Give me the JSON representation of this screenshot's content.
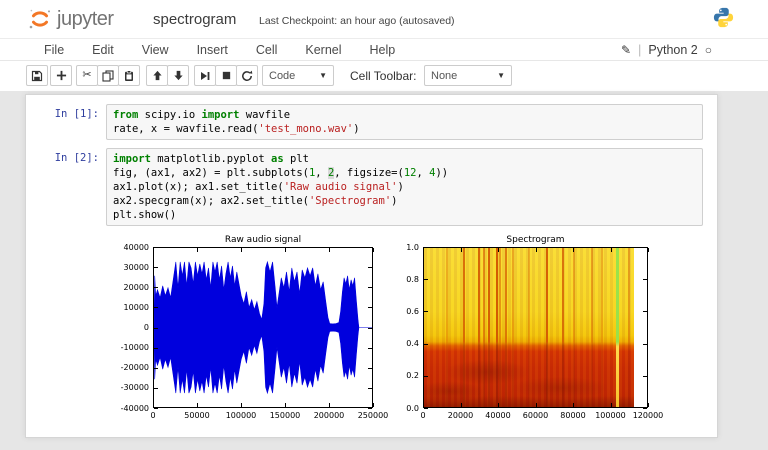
{
  "header": {
    "logo_word": "jupyter",
    "title": "spectrogram",
    "checkpoint": "Last Checkpoint: an hour ago (autosaved)"
  },
  "menu": {
    "items": [
      "File",
      "Edit",
      "View",
      "Insert",
      "Cell",
      "Kernel",
      "Help"
    ],
    "kernel_name": "Python 2"
  },
  "toolbar": {
    "buttons": [
      "save",
      "add-cell",
      "cut",
      "copy",
      "paste",
      "move-up",
      "move-down",
      "run",
      "stop",
      "restart-kernel"
    ],
    "cell_type_value": "Code",
    "cell_toolbar_label": "Cell Toolbar:",
    "cell_toolbar_value": "None"
  },
  "syntax_colors": {
    "kw": "#008000",
    "str": "#BA2121",
    "num": "#008000",
    "pl": "#000000",
    "prompt": "#303F9F"
  },
  "cells": [
    {
      "prompt": "In [1]:",
      "lines": [
        [
          {
            "t": "kw",
            "v": "from"
          },
          {
            "t": "pl",
            "v": " scipy.io "
          },
          {
            "t": "kw",
            "v": "import"
          },
          {
            "t": "pl",
            "v": " wavfile"
          }
        ],
        [
          {
            "t": "pl",
            "v": "rate, x = wavfile.read("
          },
          {
            "t": "str",
            "v": "'test_mono.wav'"
          },
          {
            "t": "pl",
            "v": ")"
          }
        ]
      ]
    },
    {
      "prompt": "In [2]:",
      "lines": [
        [
          {
            "t": "kw",
            "v": "import"
          },
          {
            "t": "pl",
            "v": " matplotlib.pyplot "
          },
          {
            "t": "kw",
            "v": "as"
          },
          {
            "t": "pl",
            "v": " plt"
          }
        ],
        [
          {
            "t": "pl",
            "v": "fig, (ax1, ax2) = plt.subplots("
          },
          {
            "t": "num",
            "v": "1"
          },
          {
            "t": "pl",
            "v": ", "
          },
          {
            "t": "num",
            "v": "2",
            "sel": true
          },
          {
            "t": "pl",
            "v": ", figsize=("
          },
          {
            "t": "num",
            "v": "12"
          },
          {
            "t": "pl",
            "v": ", "
          },
          {
            "t": "num",
            "v": "4"
          },
          {
            "t": "pl",
            "v": "))"
          }
        ],
        [
          {
            "t": "pl",
            "v": "ax1.plot(x); ax1.set_title("
          },
          {
            "t": "str",
            "v": "'Raw audio signal'"
          },
          {
            "t": "pl",
            "v": ")"
          }
        ],
        [
          {
            "t": "pl",
            "v": "ax2.specgram(x); ax2.set_title("
          },
          {
            "t": "str",
            "v": "'Spectrogram'"
          },
          {
            "t": "pl",
            "v": ")"
          }
        ],
        [
          {
            "t": "pl",
            "v": "plt.show()"
          }
        ]
      ]
    }
  ],
  "chart_data": [
    {
      "type": "line",
      "title": "Raw audio signal",
      "xlim": [
        0,
        250000
      ],
      "ylim": [
        -40000,
        40000
      ],
      "xticks": [
        0,
        50000,
        100000,
        150000,
        200000,
        250000
      ],
      "yticks": [
        -40000,
        -30000,
        -20000,
        -10000,
        0,
        10000,
        20000,
        30000,
        40000
      ],
      "line_color": "#0000dd",
      "grid": false,
      "series": [
        {
          "name": "waveform-envelope",
          "points": [
            [
              0,
              0
            ],
            [
              800,
              26000
            ],
            [
              2000,
              16000
            ],
            [
              4000,
              19000
            ],
            [
              7000,
              15000
            ],
            [
              10000,
              21000
            ],
            [
              13000,
              16000
            ],
            [
              16000,
              20000
            ],
            [
              19000,
              15000
            ],
            [
              22000,
              24000
            ],
            [
              25000,
              33000
            ],
            [
              27500,
              20000
            ],
            [
              30000,
              33000
            ],
            [
              32500,
              26000
            ],
            [
              35000,
              33000
            ],
            [
              37500,
              21000
            ],
            [
              40000,
              33000
            ],
            [
              42500,
              30000
            ],
            [
              45000,
              22000
            ],
            [
              47500,
              33000
            ],
            [
              50000,
              26000
            ],
            [
              52500,
              32000
            ],
            [
              55000,
              27000
            ],
            [
              57500,
              33000
            ],
            [
              60000,
              24000
            ],
            [
              62500,
              30000
            ],
            [
              65000,
              20000
            ],
            [
              67500,
              33000
            ],
            [
              70000,
              28000
            ],
            [
              72500,
              33000
            ],
            [
              75000,
              24000
            ],
            [
              77500,
              31000
            ],
            [
              80000,
              19000
            ],
            [
              82500,
              27000
            ],
            [
              85000,
              33000
            ],
            [
              87500,
              25000
            ],
            [
              90000,
              31000
            ],
            [
              92500,
              21000
            ],
            [
              95000,
              28000
            ],
            [
              97500,
              22000
            ],
            [
              100000,
              16000
            ],
            [
              103000,
              12000
            ],
            [
              106000,
              18000
            ],
            [
              109000,
              10000
            ],
            [
              112000,
              14000
            ],
            [
              115000,
              9000
            ],
            [
              118000,
              13000
            ],
            [
              121000,
              7000
            ],
            [
              123500,
              4000
            ],
            [
              126000,
              12000
            ],
            [
              128000,
              30000
            ],
            [
              130000,
              33000
            ],
            [
              133000,
              28000
            ],
            [
              136000,
              33000
            ],
            [
              139000,
              20000
            ],
            [
              141000,
              10000
            ],
            [
              143000,
              16000
            ],
            [
              146000,
              25000
            ],
            [
              149000,
              20000
            ],
            [
              152000,
              28000
            ],
            [
              155000,
              18000
            ],
            [
              158000,
              30000
            ],
            [
              161000,
              23000
            ],
            [
              164000,
              28000
            ],
            [
              167000,
              17000
            ],
            [
              170000,
              29000
            ],
            [
              173000,
              25000
            ],
            [
              176000,
              30000
            ],
            [
              179000,
              26000
            ],
            [
              182000,
              30000
            ],
            [
              185000,
              21000
            ],
            [
              188000,
              27000
            ],
            [
              191000,
              19000
            ],
            [
              194000,
              23000
            ],
            [
              197000,
              13000
            ],
            [
              199500,
              5000
            ],
            [
              201500,
              2000
            ],
            [
              205000,
              1800
            ],
            [
              209000,
              2000
            ],
            [
              212000,
              2500
            ],
            [
              214000,
              8000
            ],
            [
              216000,
              18000
            ],
            [
              218000,
              25000
            ],
            [
              220000,
              22000
            ],
            [
              222000,
              26000
            ],
            [
              224000,
              19000
            ],
            [
              226000,
              24000
            ],
            [
              228000,
              21000
            ],
            [
              230000,
              25000
            ],
            [
              232000,
              14000
            ],
            [
              234000,
              4000
            ],
            [
              235000,
              0
            ],
            [
              250000,
              0
            ]
          ]
        }
      ]
    },
    {
      "type": "heatmap",
      "title": "Spectrogram",
      "xlim": [
        0,
        120000
      ],
      "ylim": [
        0,
        1.0
      ],
      "xticks": [
        0,
        20000,
        40000,
        60000,
        80000,
        100000,
        120000
      ],
      "yticks": [
        0.0,
        0.2,
        0.4,
        0.6,
        0.8,
        1.0
      ],
      "data_end_x": 113000,
      "band_boundary_y": 0.4,
      "colors": {
        "top_band": "#f8d825",
        "bottom_band": "#c62d04",
        "dark": "#7c1a02",
        "accent_line": "#9be04a"
      },
      "vertical_streaks": [
        {
          "x": 12000,
          "opacity": 0.35
        },
        {
          "x": 21000,
          "opacity": 0.8
        },
        {
          "x": 29000,
          "opacity": 0.85
        },
        {
          "x": 31500,
          "opacity": 0.6
        },
        {
          "x": 34500,
          "opacity": 0.9
        },
        {
          "x": 38500,
          "opacity": 0.95
        },
        {
          "x": 40500,
          "opacity": 0.5
        },
        {
          "x": 43500,
          "opacity": 0.7
        },
        {
          "x": 47500,
          "opacity": 0.4
        },
        {
          "x": 56000,
          "opacity": 0.35
        },
        {
          "x": 65500,
          "opacity": 0.9
        },
        {
          "x": 74000,
          "opacity": 0.75
        },
        {
          "x": 80000,
          "opacity": 0.4
        },
        {
          "x": 90000,
          "opacity": 0.45
        },
        {
          "x": 95500,
          "opacity": 0.35
        },
        {
          "x": 110000,
          "opacity": 0.4
        }
      ],
      "accent_line_x": 103500
    }
  ]
}
